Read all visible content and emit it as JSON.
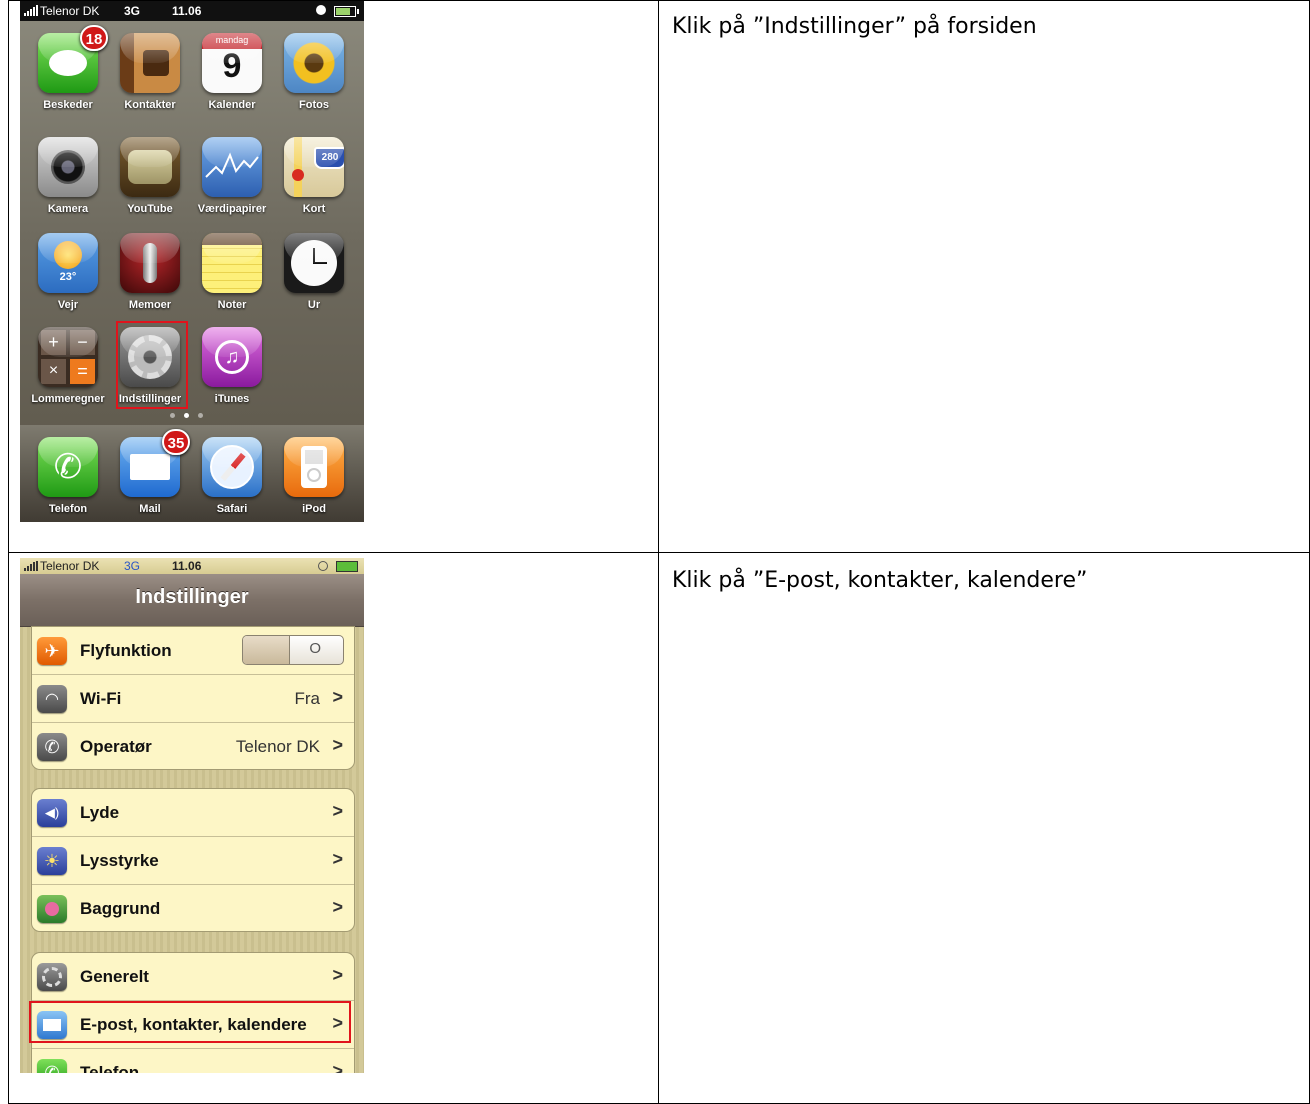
{
  "instructions": [
    "Klik på ”Indstillinger” på forsiden",
    "Klik på ”E-post, kontakter, kalendere”"
  ],
  "home_screen": {
    "status": {
      "carrier": "Telenor DK",
      "network": "3G",
      "time": "11.06"
    },
    "calendar": {
      "weekday": "mandag",
      "day": "9"
    },
    "weather_temp": "23°",
    "maps_sign": "280",
    "apps": [
      {
        "label": "Beskeder",
        "badge": "18"
      },
      {
        "label": "Kontakter"
      },
      {
        "label": "Kalender"
      },
      {
        "label": "Fotos"
      },
      {
        "label": "Kamera"
      },
      {
        "label": "YouTube"
      },
      {
        "label": "Værdipapirer"
      },
      {
        "label": "Kort"
      },
      {
        "label": "Vejr"
      },
      {
        "label": "Memoer"
      },
      {
        "label": "Noter"
      },
      {
        "label": "Ur"
      },
      {
        "label": "Lommeregner"
      },
      {
        "label": "Indstillinger"
      },
      {
        "label": "iTunes"
      }
    ],
    "dock": [
      {
        "label": "Telefon"
      },
      {
        "label": "Mail",
        "badge": "35"
      },
      {
        "label": "Safari"
      },
      {
        "label": "iPod"
      }
    ]
  },
  "settings_screen": {
    "status": {
      "carrier": "Telenor DK",
      "network": "3G",
      "time": "11.06"
    },
    "title": "Indstillinger",
    "airplane": {
      "label": "Flyfunktion",
      "toggle": "O"
    },
    "wifi": {
      "label": "Wi-Fi",
      "value": "Fra"
    },
    "carrier_row": {
      "label": "Operatør",
      "value": "Telenor DK"
    },
    "sounds": {
      "label": "Lyde"
    },
    "brightness": {
      "label": "Lysstyrke"
    },
    "wallpaper": {
      "label": "Baggrund"
    },
    "general": {
      "label": "Generelt"
    },
    "mail": {
      "label": "E-post, kontakter, kalendere"
    },
    "phone": {
      "label": "Telefon"
    },
    "chevron": ">"
  }
}
